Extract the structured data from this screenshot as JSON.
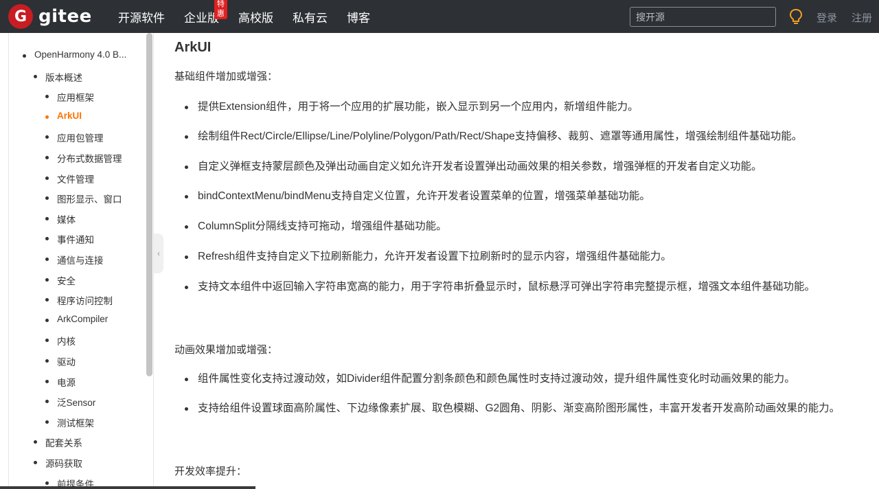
{
  "header": {
    "logo_glyph": "G",
    "logo_text": "gitee",
    "nav": [
      "开源软件",
      "企业版",
      "高校版",
      "私有云",
      "博客"
    ],
    "badge": "特惠",
    "search_placeholder": "搜开源",
    "login": "登录",
    "register": "注册",
    "bulb_color": "#f0a020"
  },
  "sidebar": {
    "items": [
      {
        "label": "OpenHarmony 4.0 B...",
        "level": 0
      },
      {
        "label": "版本概述",
        "level": 1
      },
      {
        "label": "应用框架",
        "level": 2
      },
      {
        "label": "ArkUI",
        "level": 2,
        "active": true
      },
      {
        "label": "应用包管理",
        "level": 2
      },
      {
        "label": "分布式数据管理",
        "level": 2
      },
      {
        "label": "文件管理",
        "level": 2
      },
      {
        "label": "图形显示、窗口",
        "level": 2
      },
      {
        "label": "媒体",
        "level": 2
      },
      {
        "label": "事件通知",
        "level": 2
      },
      {
        "label": "通信与连接",
        "level": 2
      },
      {
        "label": "安全",
        "level": 2
      },
      {
        "label": "程序访问控制",
        "level": 2
      },
      {
        "label": "ArkCompiler",
        "level": 2
      },
      {
        "label": "内核",
        "level": 2
      },
      {
        "label": "驱动",
        "level": 2
      },
      {
        "label": "电源",
        "level": 2
      },
      {
        "label": "泛Sensor",
        "level": 2
      },
      {
        "label": "测试框架",
        "level": 2
      },
      {
        "label": "配套关系",
        "level": 1
      },
      {
        "label": "源码获取",
        "level": 1
      },
      {
        "label": "前提条件",
        "level": 2
      }
    ],
    "collapse_glyph": "‹"
  },
  "content": {
    "title": "ArkUI",
    "section1": "基础组件增加或增强：",
    "bullets1": [
      "提供Extension组件，用于将一个应用的扩展功能，嵌入显示到另一个应用内，新增组件能力。",
      "绘制组件Rect/Circle/Ellipse/Line/Polyline/Polygon/Path/Rect/Shape支持偏移、裁剪、遮罩等通用属性，增强绘制组件基础功能。",
      "自定义弹框支持蒙层颜色及弹出动画自定义如允许开发者设置弹出动画效果的相关参数，增强弹框的开发者自定义功能。",
      "bindContextMenu/bindMenu支持自定义位置，允许开发者设置菜单的位置，增强菜单基础功能。",
      "ColumnSplit分隔线支持可拖动，增强组件基础功能。",
      "Refresh组件支持自定义下拉刷新能力，允许开发者设置下拉刷新时的显示内容，增强组件基础能力。",
      "支持文本组件中返回输入字符串宽高的能力，用于字符串折叠显示时，鼠标悬浮可弹出字符串完整提示框，增强文本组件基础功能。"
    ],
    "section2": "动画效果增加或增强：",
    "bullets2": [
      "组件属性变化支持过渡动效，如Divider组件配置分割条颜色和颜色属性时支持过渡动效，提升组件属性变化时动画效果的能力。",
      "支持给组件设置球面高阶属性、下边缘像素扩展、取色模糊、G2圆角、阴影、渐变高阶图形属性，丰富开发者开发高阶动画效果的能力。"
    ],
    "section3": "开发效率提升："
  }
}
